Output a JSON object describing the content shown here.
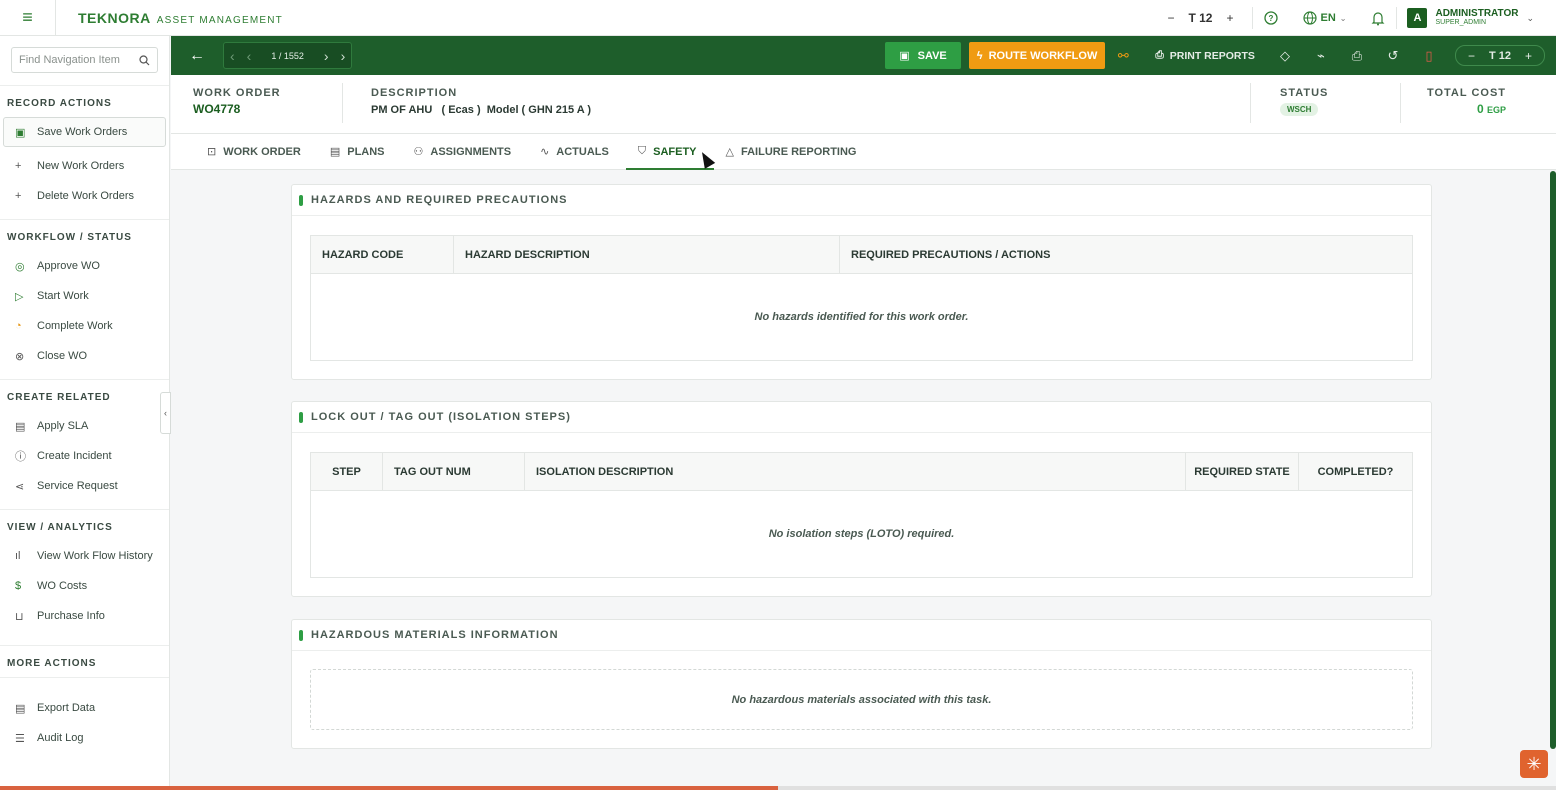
{
  "topbar": {
    "brand_name": "TEKNORA",
    "brand_sub": "ASSET MANAGEMENT",
    "font_size": "12",
    "language": "EN",
    "user_initial": "A",
    "user_name": "ADMINISTRATOR",
    "user_role": "SUPER_ADMIN"
  },
  "sidebar": {
    "search_placeholder": "Find Navigation Item",
    "sections": {
      "record_actions": "RECORD ACTIONS",
      "workflow_status": "WORKFLOW / STATUS",
      "create_related": "CREATE RELATED",
      "view_analytics": "VIEW / ANALYTICS",
      "more_actions": "MORE ACTIONS"
    },
    "items": {
      "save": "Save Work Orders",
      "new": "New Work Orders",
      "delete": "Delete Work Orders",
      "approve": "Approve WO",
      "start": "Start Work",
      "complete": "Complete Work",
      "close": "Close WO",
      "apply_sla": "Apply SLA",
      "create_incident": "Create Incident",
      "service_request": "Service Request",
      "workflow_history": "View Work Flow History",
      "wo_costs": "WO Costs",
      "purchase_info": "Purchase Info",
      "export_data": "Export Data",
      "audit_log": "Audit Log"
    }
  },
  "toolbar": {
    "record_position": "1",
    "record_total": "1552",
    "save_label": "SAVE",
    "route_label": "ROUTE WORKFLOW",
    "print_label": "PRINT REPORTS",
    "font_size": "12"
  },
  "header": {
    "wo_label": "WORK ORDER",
    "wo_value": "WO4778",
    "desc_label": "DESCRIPTION",
    "desc_value": "PM OF AHU   ( Ecas )  Model ( GHN 215 A )",
    "status_label": "STATUS",
    "status_value": "WSCH",
    "cost_label": "TOTAL COST",
    "cost_value": "0",
    "cost_unit": "EGP"
  },
  "tabs": {
    "work_order": "WORK ORDER",
    "plans": "PLANS",
    "assignments": "ASSIGNMENTS",
    "actuals": "ACTUALS",
    "safety": "SAFETY",
    "failure": "FAILURE REPORTING"
  },
  "hazards": {
    "title": "HAZARDS AND REQUIRED PRECAUTIONS",
    "col_code": "HAZARD CODE",
    "col_desc": "HAZARD DESCRIPTION",
    "col_prec": "REQUIRED PRECAUTIONS / ACTIONS",
    "empty": "No hazards identified for this work order."
  },
  "loto": {
    "title": "LOCK OUT / TAG OUT (ISOLATION STEPS)",
    "col_step": "STEP",
    "col_tag": "TAG OUT NUM",
    "col_desc": "ISOLATION DESCRIPTION",
    "col_state": "REQUIRED STATE",
    "col_completed": "COMPLETED?",
    "empty": "No isolation steps (LOTO) required."
  },
  "hazmat": {
    "title": "HAZARDOUS MATERIALS INFORMATION",
    "empty": "No hazardous materials associated with this task."
  },
  "progress": {
    "fraction": 0.5
  },
  "colors": {
    "brand": "#2e7d32",
    "toolbar": "#1e5e2b",
    "route": "#f09b12",
    "save": "#2e9e44"
  }
}
